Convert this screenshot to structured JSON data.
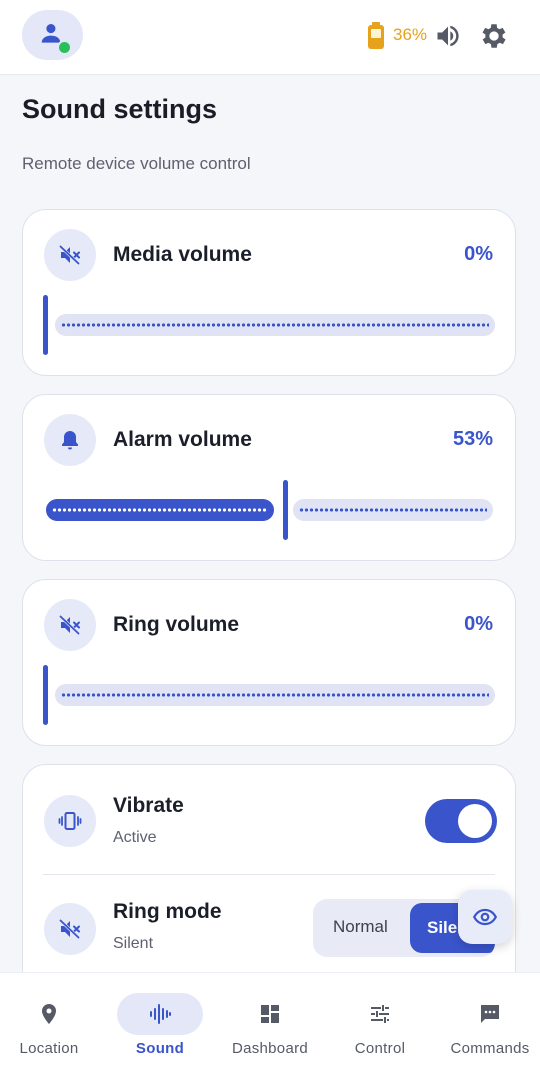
{
  "status": {
    "battery_percent": "36%",
    "battery_color": "#e6a21a"
  },
  "header": {
    "title": "Sound settings",
    "subtitle": "Remote device volume control"
  },
  "volumes": [
    {
      "label": "Media volume",
      "value": "0%",
      "level": 0,
      "icon": "volume-off-icon"
    },
    {
      "label": "Alarm volume",
      "value": "53%",
      "level": 0.53,
      "icon": "alarm-bell-icon"
    },
    {
      "label": "Ring volume",
      "value": "0%",
      "level": 0,
      "icon": "volume-off-icon"
    }
  ],
  "vibrate": {
    "label": "Vibrate",
    "status": "Active",
    "enabled": true
  },
  "ring_mode": {
    "label": "Ring mode",
    "status": "Silent",
    "options": [
      "Normal",
      "Silent"
    ],
    "selected": "Silent"
  },
  "nav": [
    {
      "label": "Location",
      "icon": "location-pin-icon",
      "active": false
    },
    {
      "label": "Sound",
      "icon": "sound-wave-icon",
      "active": true
    },
    {
      "label": "Dashboard",
      "icon": "dashboard-icon",
      "active": false
    },
    {
      "label": "Control",
      "icon": "sliders-icon",
      "active": false
    },
    {
      "label": "Commands",
      "icon": "chat-bubble-icon",
      "active": false
    }
  ],
  "colors": {
    "accent": "#3a55cc",
    "track": "#dfe3f3",
    "online": "#2bbf5c"
  }
}
